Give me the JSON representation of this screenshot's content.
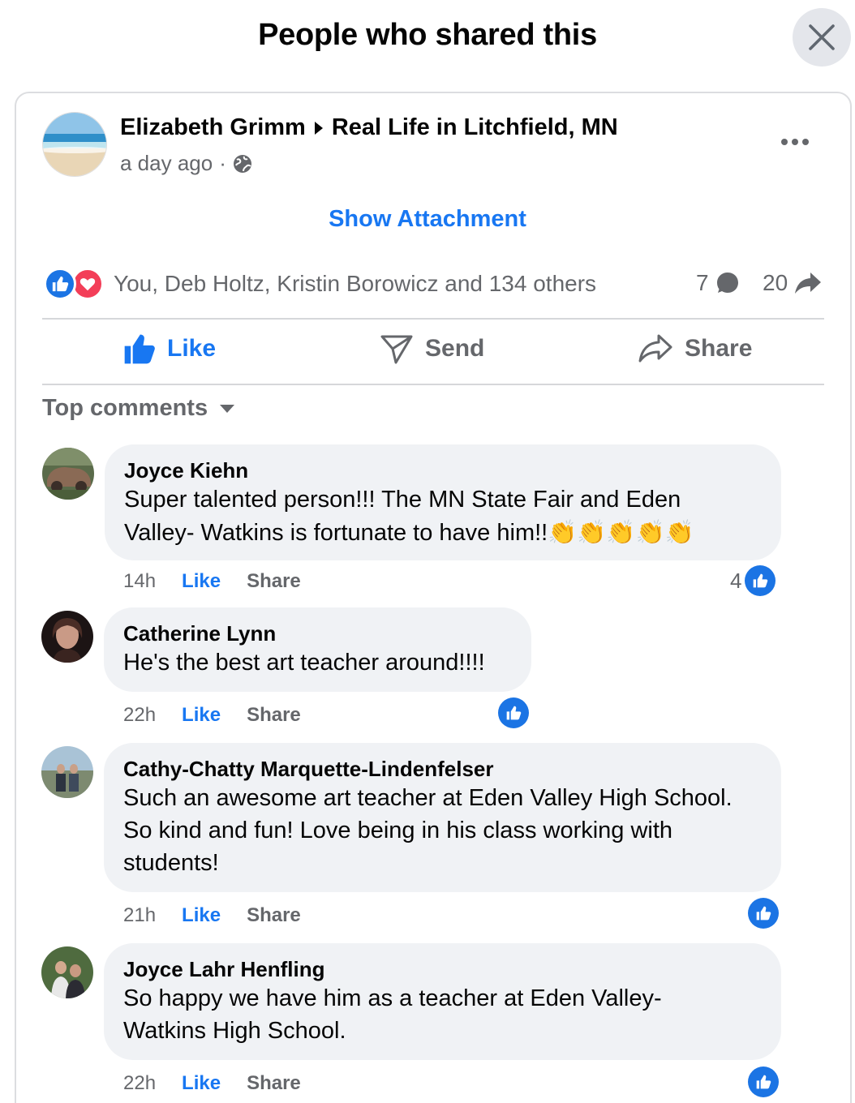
{
  "modal": {
    "title": "People who shared this"
  },
  "post": {
    "author": "Elizabeth Grimm",
    "group": "Real Life in Litchfield, MN",
    "time": "a day ago",
    "separator": "·",
    "show_attachment": "Show Attachment",
    "reactors": "You, Deb Holtz, Kristin Borowicz and 134 others",
    "comment_count": "7",
    "share_count": "20"
  },
  "actions": {
    "like": "Like",
    "send": "Send",
    "share": "Share"
  },
  "comments_header": "Top comments",
  "comments": [
    {
      "name": "Joyce Kiehn",
      "text_line1": "Super talented person!!! The MN State Fair and Eden",
      "text_line2": "Valley- Watkins is fortunate to have him!!",
      "emoji": "👏👏👏👏👏",
      "time": "14h",
      "like": "Like",
      "share": "Share",
      "reactions": "4"
    },
    {
      "name": "Catherine Lynn",
      "text": "He's the best art teacher around!!!!",
      "time": "22h",
      "like": "Like",
      "share": "Share"
    },
    {
      "name": "Cathy-Chatty Marquette-Lindenfelser",
      "text": "Such an awesome art teacher at Eden Valley High School. So kind and fun! Love being in his class working with students!",
      "time": "21h",
      "like": "Like",
      "share": "Share"
    },
    {
      "name": "Joyce Lahr Henfling",
      "text": "So happy we have him as a teacher at Eden Valley-Watkins High School.",
      "time": "22h",
      "like": "Like",
      "share": "Share"
    }
  ],
  "colors": {
    "accent": "#1877f2",
    "like_badge": "#1b74e4",
    "love_badge": "#f33e58",
    "bubble": "#f0f2f5",
    "secondary_text": "#65676b"
  },
  "icons": [
    "close-icon",
    "caret-right-icon",
    "globe-icon",
    "more-icon",
    "like-reaction-icon",
    "love-reaction-icon",
    "comment-icon",
    "share-arrow-icon",
    "thumbs-up-icon",
    "send-icon",
    "share-icon",
    "dropdown-caret-icon"
  ]
}
